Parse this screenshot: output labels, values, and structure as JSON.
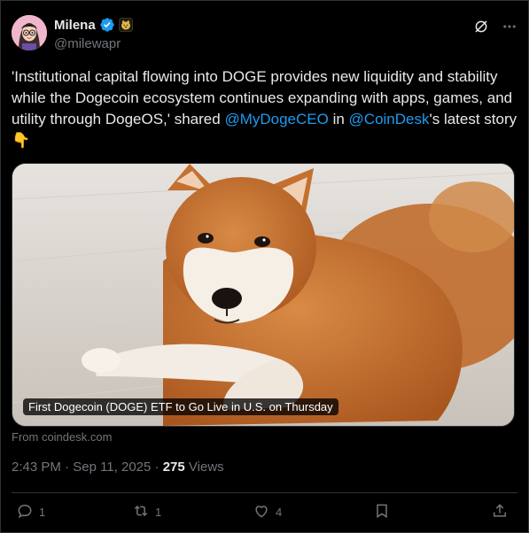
{
  "user": {
    "name": "Milena",
    "handle": "@milewapr"
  },
  "tweet": {
    "text_parts": [
      "'Institutional capital flowing into DOGE provides new liquidity and stability while the Dogecoin ecosystem continues expanding with apps, games, and utility through DogeOS,' shared ",
      "@MyDogeCEO",
      " in ",
      "@CoinDesk",
      "'s latest story ",
      "👇"
    ]
  },
  "media": {
    "caption": "First Dogecoin (DOGE) ETF to Go Live in U.S. on Thursday",
    "source": "From coindesk.com"
  },
  "meta": {
    "time": "2:43 PM",
    "date": "Sep 11, 2025",
    "sep": "·",
    "views_count": "275",
    "views_label": "Views"
  },
  "actions": {
    "replies": "1",
    "reposts": "1",
    "likes": "4"
  },
  "colors": {
    "background": "#000000",
    "text": "#e7e9ea",
    "muted": "#71767b",
    "link": "#1d9bf0",
    "border": "#2f3336",
    "verified": "#1d9bf0"
  },
  "icons": [
    "avatar",
    "verified-icon",
    "affiliate-badge-icon",
    "grok-icon",
    "more-icon",
    "reply-icon",
    "repost-icon",
    "like-icon",
    "bookmark-icon",
    "share-icon"
  ]
}
